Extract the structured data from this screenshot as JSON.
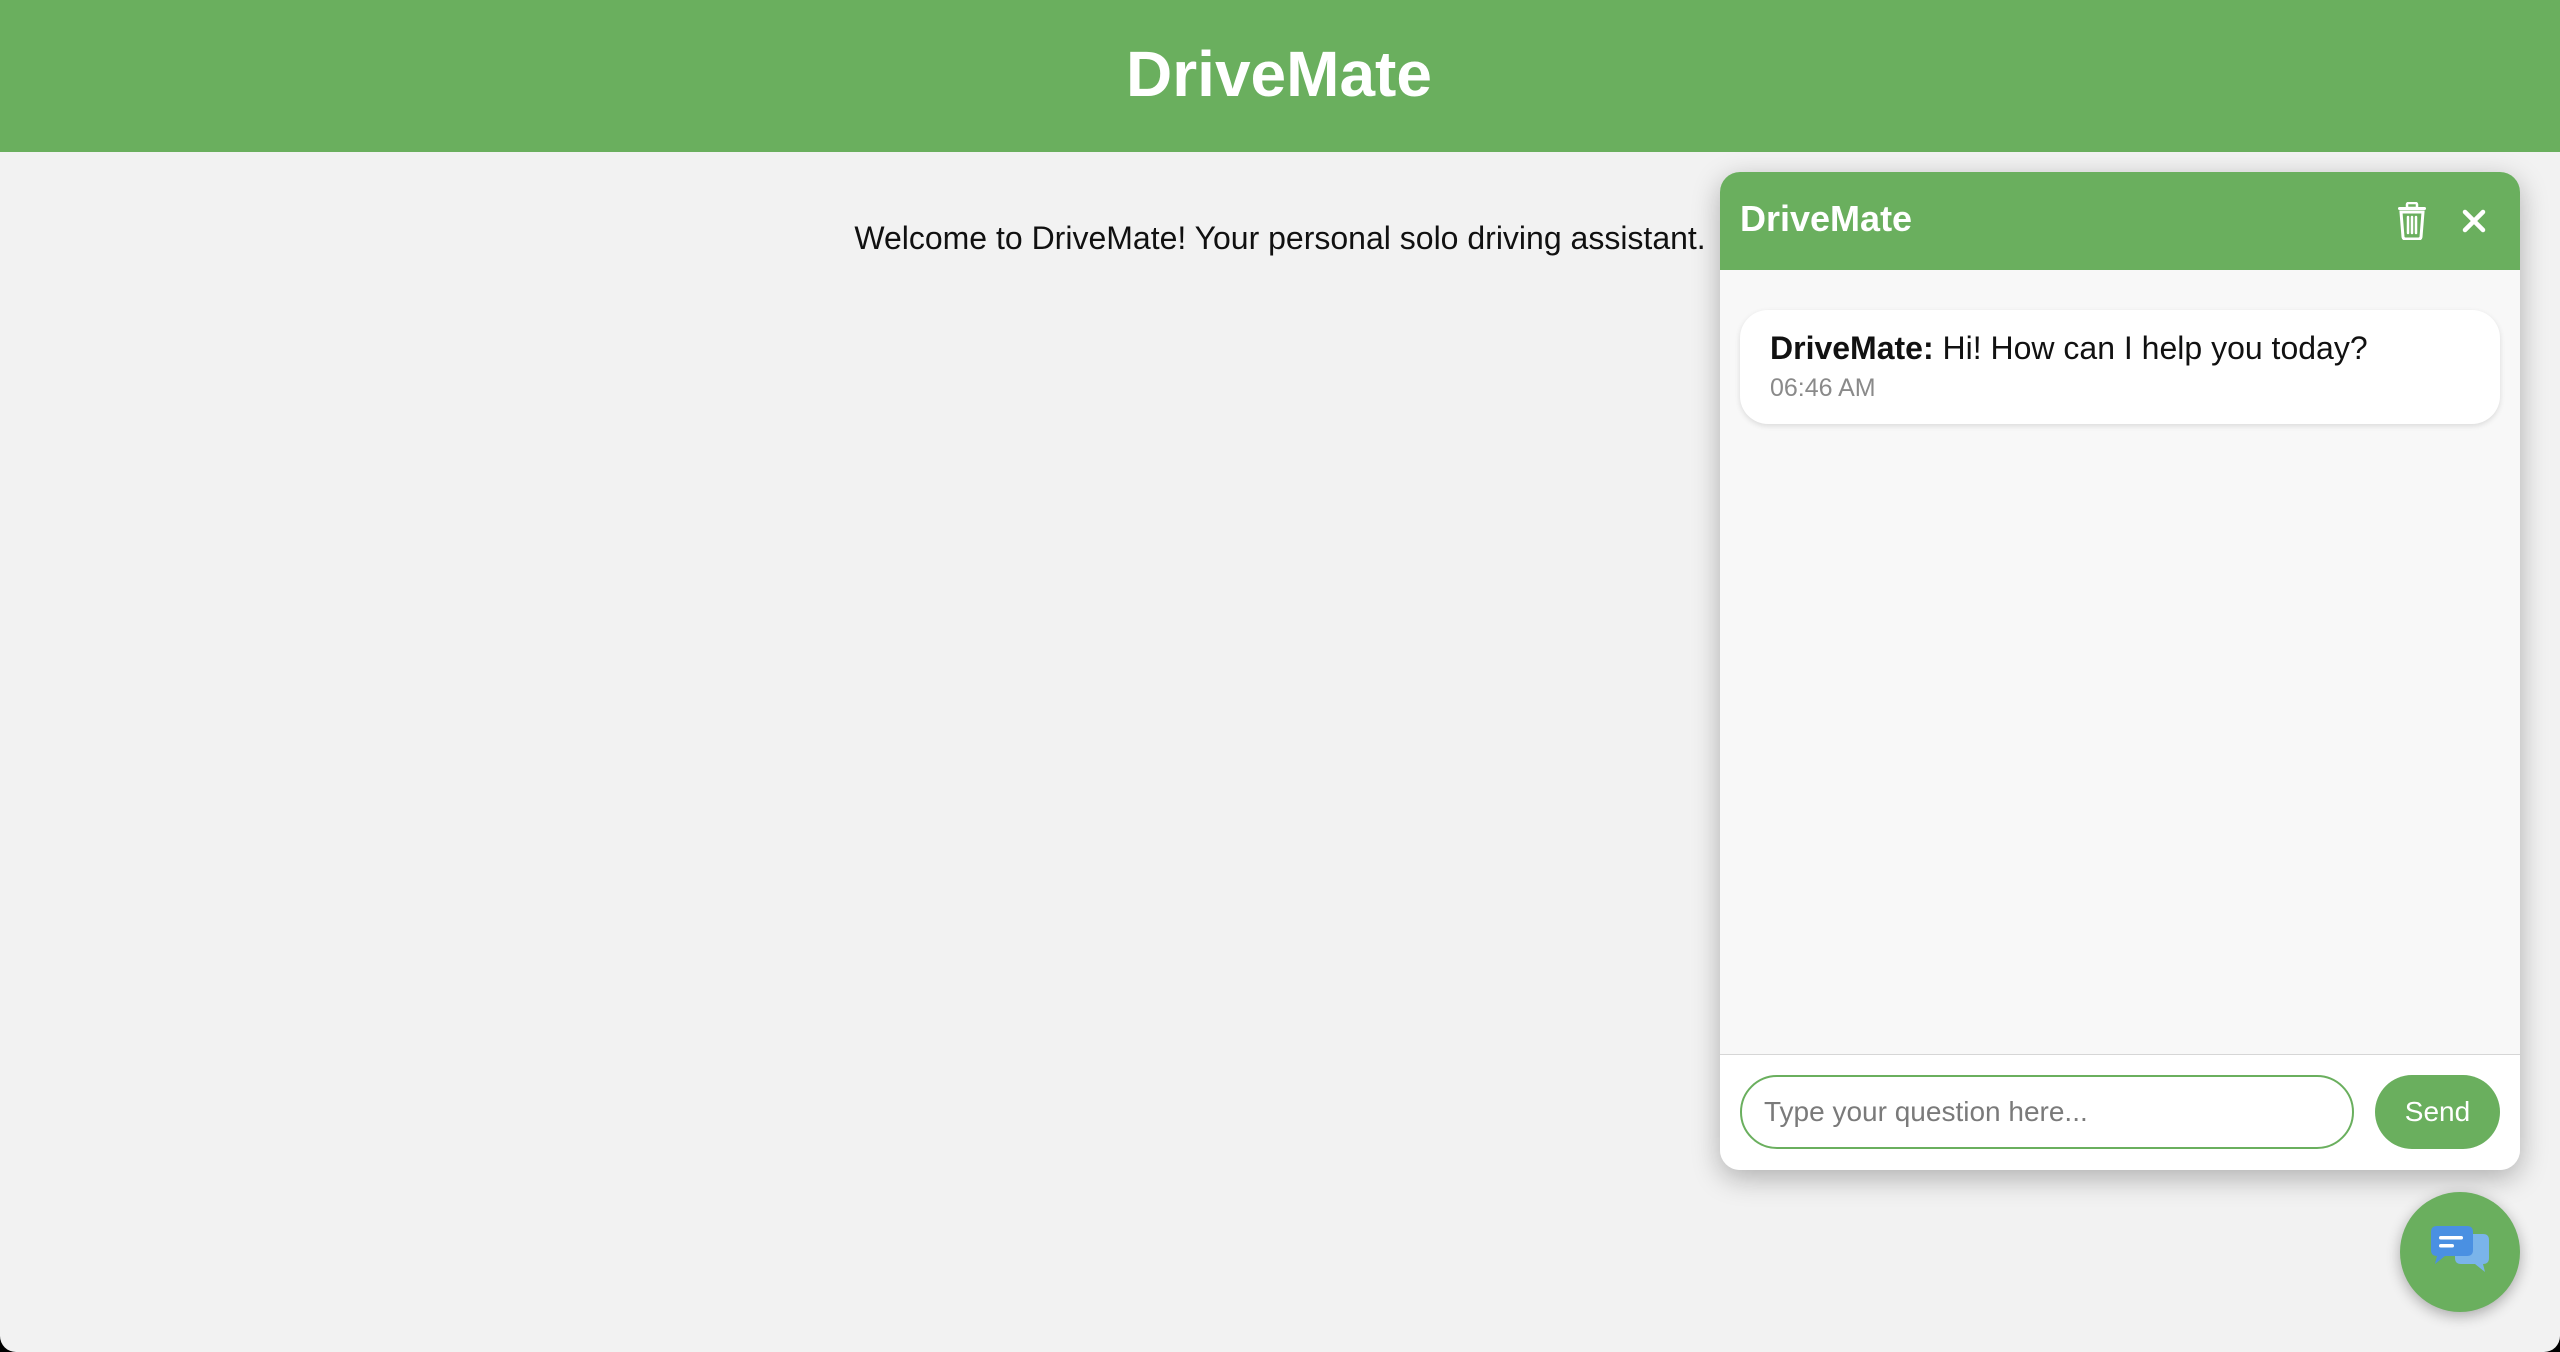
{
  "header": {
    "title": "DriveMate"
  },
  "main": {
    "welcome_text": "Welcome to DriveMate! Your personal solo driving assistant."
  },
  "chat": {
    "title": "DriveMate",
    "trash_icon": "trash-icon",
    "close_icon": "close-icon",
    "messages": [
      {
        "sender": "DriveMate:",
        "text": " Hi! How can I help you today?",
        "time": "06:46 AM"
      }
    ],
    "input": {
      "placeholder": "Type your question here...",
      "value": ""
    },
    "send_label": "Send"
  },
  "fab": {
    "icon": "chat-bubbles-icon"
  },
  "colors": {
    "brand_green": "#6aaf5e",
    "chat_icon_blue": "#4a90e2"
  }
}
